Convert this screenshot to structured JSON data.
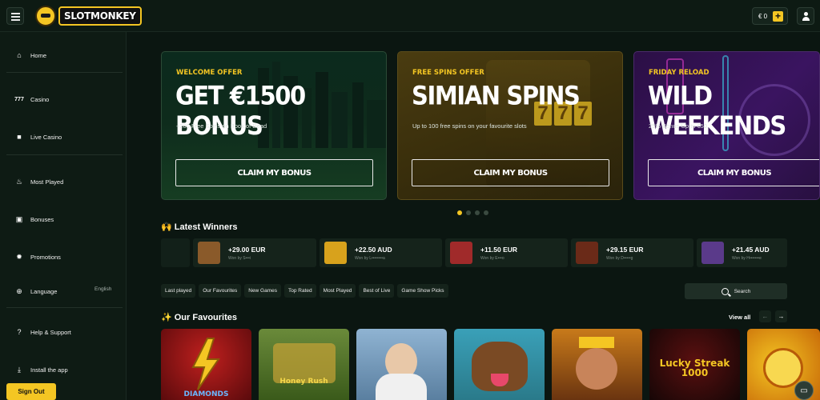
{
  "brand": {
    "name": "SLOTMONKEY"
  },
  "wallet": {
    "balance": "€ 0",
    "add": "+"
  },
  "sidebar": {
    "items": [
      {
        "label": "Home",
        "icon": "home-icon"
      },
      {
        "label": "Casino",
        "icon": "slot-777-icon"
      },
      {
        "label": "Live Casino",
        "icon": "video-camera-icon"
      },
      {
        "label": "Most Played",
        "icon": "fire-icon"
      },
      {
        "label": "Bonuses",
        "icon": "gift-icon"
      },
      {
        "label": "Promotions",
        "icon": "gear-badge-icon"
      },
      {
        "label": "Language",
        "icon": "globe-icon",
        "value": "English"
      },
      {
        "label": "Help & Support",
        "icon": "question-icon"
      },
      {
        "label": "Install the app",
        "icon": "download-icon"
      }
    ],
    "sign_out": "Sign Out"
  },
  "promos": [
    {
      "overline": "WELCOME OFFER",
      "headline": "GET €1500 BONUS",
      "sub": "+200 Free Spins on Book of Dead",
      "cta": "CLAIM MY BONUS"
    },
    {
      "overline": "FREE SPINS OFFER",
      "headline": "SIMIAN SPINS",
      "sub": "Up to 100 free spins on your favourite slots",
      "cta": "CLAIM MY BONUS"
    },
    {
      "overline": "FRIDAY RELOAD",
      "headline": "WILD WEEKENDS",
      "sub": "25% Bonus Up to €50",
      "cta": "CLAIM MY BONUS"
    }
  ],
  "carousel": {
    "active": 0,
    "count": 4
  },
  "winners": {
    "title": "🙌 Latest Winners",
    "items": [
      {
        "amount": "+29.00 EUR",
        "who": "Won by S•••i",
        "color": "#8a5a2a"
      },
      {
        "amount": "+22.50 AUD",
        "who": "Won by L••••••••a",
        "color": "#d8a21c"
      },
      {
        "amount": "+11.50 EUR",
        "who": "Won by E•••o",
        "color": "#a02a2a"
      },
      {
        "amount": "+29.15 EUR",
        "who": "Won by D•••••g",
        "color": "#6a2a18"
      },
      {
        "amount": "+21.45 AUD",
        "who": "Won by H•••••••e",
        "color": "#5a3a8a"
      }
    ]
  },
  "filters": [
    "Last played",
    "Our Favourites",
    "New Games",
    "Top Rated",
    "Most Played",
    "Best of Live",
    "Game Show Picks"
  ],
  "search": {
    "label": "Search"
  },
  "favourites": {
    "title": "✨ Our Favourites",
    "view_all": "View all",
    "games": [
      {
        "label": "DIAMONDS",
        "color": "#8c1416"
      },
      {
        "label": "Honey Rush",
        "color": "#4a6a2a"
      },
      {
        "label": "",
        "color": "#6d8fae"
      },
      {
        "label": "",
        "color": "#3a8a9a"
      },
      {
        "label": "",
        "color": "#8a4a14"
      },
      {
        "label": "Lucky Streak 1000",
        "color": "#2a0a0a"
      },
      {
        "label": "",
        "color": "#c98a10"
      }
    ]
  }
}
